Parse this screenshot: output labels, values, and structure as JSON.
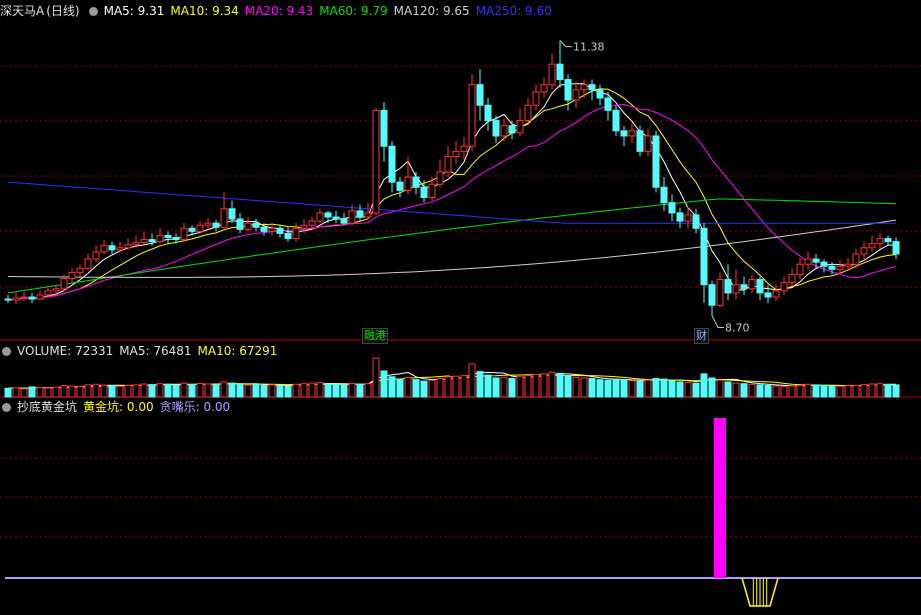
{
  "colors": {
    "background": "#000000",
    "up": "#ff3232",
    "down": "#54fcfc",
    "ma5": "#ffffff",
    "ma10": "#ffff00",
    "ma20": "#ff00ff",
    "ma60": "#00e000",
    "ma120": "#cfcfcf",
    "ma250": "#3030ff",
    "grid": "#8b0000",
    "separator": "#b00000",
    "signal_bar": "#ff00ff",
    "signal_baseline": "#b0a0ff",
    "trap": "#ffff00"
  },
  "main_panel": {
    "stock_name": "深天马A",
    "period": "(日线)",
    "ma_labels": [
      {
        "label": "MA5: 9.31",
        "color": "#ffffff"
      },
      {
        "label": "MA10: 9.34",
        "color": "#ffff00"
      },
      {
        "label": "MA20: 9.43",
        "color": "#ff00ff"
      },
      {
        "label": "MA60: 9.79",
        "color": "#00e000"
      },
      {
        "label": "MA120: 9.65",
        "color": "#cfcfcf"
      },
      {
        "label": "MA250: 9.60",
        "color": "#3030ff"
      }
    ],
    "max_label": "11.38",
    "min_label": "8.70",
    "tags": [
      "融港",
      "财"
    ]
  },
  "volume_panel": {
    "title": "VOLUME: 72331",
    "ma5": "MA5: 76481",
    "ma10": "MA10: 67291"
  },
  "indicator_panel": {
    "name": "抄底黄金坑",
    "gold": "黄金坑: 0.00",
    "greed": "贪嘴乐: 0.00"
  },
  "chart_data": {
    "type": "candlestick",
    "ylim": [
      8.5,
      11.6
    ],
    "candles": [
      [
        8.86,
        8.85,
        8.9,
        8.82
      ],
      [
        8.85,
        8.87,
        8.92,
        8.81
      ],
      [
        8.87,
        8.88,
        8.93,
        8.84
      ],
      [
        8.88,
        8.86,
        8.92,
        8.82
      ],
      [
        8.86,
        8.9,
        8.94,
        8.85
      ],
      [
        8.9,
        8.94,
        8.97,
        8.88
      ],
      [
        8.94,
        8.96,
        9.0,
        8.9
      ],
      [
        8.96,
        9.06,
        9.1,
        8.94
      ],
      [
        9.06,
        9.12,
        9.16,
        9.02
      ],
      [
        9.12,
        9.16,
        9.2,
        9.08
      ],
      [
        9.16,
        9.25,
        9.3,
        9.14
      ],
      [
        9.25,
        9.32,
        9.38,
        9.22
      ],
      [
        9.32,
        9.38,
        9.44,
        9.3
      ],
      [
        9.38,
        9.34,
        9.42,
        9.3
      ],
      [
        9.34,
        9.36,
        9.42,
        9.32
      ],
      [
        9.36,
        9.39,
        9.45,
        9.34
      ],
      [
        9.39,
        9.41,
        9.48,
        9.36
      ],
      [
        9.41,
        9.44,
        9.52,
        9.38
      ],
      [
        9.44,
        9.42,
        9.5,
        9.38
      ],
      [
        9.42,
        9.48,
        9.55,
        9.4
      ],
      [
        9.48,
        9.46,
        9.52,
        9.4
      ],
      [
        9.46,
        9.44,
        9.5,
        9.4
      ],
      [
        9.44,
        9.55,
        9.6,
        9.42
      ],
      [
        9.55,
        9.52,
        9.58,
        9.48
      ],
      [
        9.52,
        9.58,
        9.62,
        9.5
      ],
      [
        9.58,
        9.6,
        9.65,
        9.55
      ],
      [
        9.6,
        9.56,
        9.63,
        9.52
      ],
      [
        9.56,
        9.74,
        9.9,
        9.55
      ],
      [
        9.74,
        9.64,
        9.82,
        9.6
      ],
      [
        9.64,
        9.54,
        9.7,
        9.5
      ],
      [
        9.54,
        9.6,
        9.66,
        9.52
      ],
      [
        9.6,
        9.56,
        9.64,
        9.52
      ],
      [
        9.56,
        9.52,
        9.6,
        9.48
      ],
      [
        9.52,
        9.55,
        9.6,
        9.48
      ],
      [
        9.55,
        9.5,
        9.58,
        9.46
      ],
      [
        9.5,
        9.45,
        9.56,
        9.42
      ],
      [
        9.45,
        9.55,
        9.6,
        9.42
      ],
      [
        9.55,
        9.58,
        9.64,
        9.5
      ],
      [
        9.58,
        9.62,
        9.66,
        9.54
      ],
      [
        9.62,
        9.7,
        9.74,
        9.6
      ],
      [
        9.7,
        9.66,
        9.72,
        9.6
      ],
      [
        9.66,
        9.64,
        9.72,
        9.6
      ],
      [
        9.64,
        9.6,
        9.7,
        9.58
      ],
      [
        9.6,
        9.72,
        9.78,
        9.58
      ],
      [
        9.72,
        9.66,
        9.78,
        9.62
      ],
      [
        9.66,
        9.7,
        9.8,
        9.64
      ],
      [
        9.7,
        10.7,
        10.72,
        9.68
      ],
      [
        10.7,
        10.35,
        10.78,
        10.2
      ],
      [
        10.35,
        10.0,
        10.4,
        9.9
      ],
      [
        10.0,
        9.92,
        10.05,
        9.85
      ],
      [
        9.92,
        10.05,
        10.25,
        9.88
      ],
      [
        10.05,
        9.95,
        10.1,
        9.88
      ],
      [
        9.95,
        9.85,
        10.02,
        9.8
      ],
      [
        9.85,
        9.98,
        10.05,
        9.82
      ],
      [
        9.98,
        10.1,
        10.22,
        9.95
      ],
      [
        10.1,
        10.25,
        10.35,
        10.05
      ],
      [
        10.25,
        10.3,
        10.4,
        10.18
      ],
      [
        10.3,
        10.35,
        10.44,
        10.22
      ],
      [
        10.35,
        10.95,
        11.05,
        10.3
      ],
      [
        10.95,
        10.75,
        11.1,
        10.6
      ],
      [
        10.75,
        10.6,
        10.82,
        10.5
      ],
      [
        10.6,
        10.45,
        10.65,
        10.38
      ],
      [
        10.45,
        10.55,
        10.62,
        10.4
      ],
      [
        10.55,
        10.48,
        10.6,
        10.42
      ],
      [
        10.48,
        10.6,
        10.72,
        10.45
      ],
      [
        10.6,
        10.75,
        10.82,
        10.55
      ],
      [
        10.75,
        10.88,
        10.95,
        10.7
      ],
      [
        10.88,
        10.95,
        11.02,
        10.82
      ],
      [
        10.95,
        11.15,
        11.25,
        10.9
      ],
      [
        11.15,
        11.0,
        11.38,
        10.92
      ],
      [
        11.0,
        10.8,
        11.05,
        10.7
      ],
      [
        10.8,
        10.9,
        10.98,
        10.72
      ],
      [
        10.9,
        10.95,
        11.0,
        10.82
      ],
      [
        10.95,
        10.9,
        11.0,
        10.8
      ],
      [
        10.9,
        10.82,
        10.95,
        10.75
      ],
      [
        10.82,
        10.7,
        10.88,
        10.6
      ],
      [
        10.7,
        10.5,
        10.75,
        10.45
      ],
      [
        10.5,
        10.45,
        10.55,
        10.35
      ],
      [
        10.45,
        10.5,
        10.58,
        10.38
      ],
      [
        10.5,
        10.3,
        10.55,
        10.25
      ],
      [
        10.3,
        10.45,
        10.52,
        10.25
      ],
      [
        10.45,
        9.95,
        10.5,
        9.9
      ],
      [
        9.95,
        9.8,
        10.05,
        9.72
      ],
      [
        9.8,
        9.7,
        9.88,
        9.62
      ],
      [
        9.7,
        9.62,
        9.75,
        9.55
      ],
      [
        9.62,
        9.68,
        9.76,
        9.55
      ],
      [
        9.68,
        9.55,
        9.74,
        9.5
      ],
      [
        9.55,
        9.0,
        9.6,
        8.82
      ],
      [
        9.0,
        8.8,
        9.04,
        8.7
      ],
      [
        8.8,
        9.05,
        9.12,
        8.78
      ],
      [
        9.05,
        8.92,
        9.2,
        8.85
      ],
      [
        8.92,
        9.0,
        9.15,
        8.86
      ],
      [
        9.0,
        8.96,
        9.08,
        8.9
      ],
      [
        8.96,
        9.05,
        9.1,
        8.92
      ],
      [
        9.05,
        8.92,
        9.08,
        8.85
      ],
      [
        8.92,
        8.88,
        9.0,
        8.82
      ],
      [
        8.88,
        8.94,
        9.0,
        8.84
      ],
      [
        8.94,
        9.02,
        9.08,
        8.9
      ],
      [
        9.02,
        9.1,
        9.16,
        8.98
      ],
      [
        9.1,
        9.2,
        9.26,
        9.05
      ],
      [
        9.2,
        9.25,
        9.32,
        9.15
      ],
      [
        9.25,
        9.22,
        9.3,
        9.16
      ],
      [
        9.22,
        9.18,
        9.25,
        9.12
      ],
      [
        9.18,
        9.15,
        9.22,
        9.1
      ],
      [
        9.15,
        9.18,
        9.24,
        9.1
      ],
      [
        9.18,
        9.2,
        9.26,
        9.14
      ],
      [
        9.2,
        9.3,
        9.35,
        9.16
      ],
      [
        9.3,
        9.36,
        9.42,
        9.25
      ],
      [
        9.36,
        9.4,
        9.48,
        9.32
      ],
      [
        9.4,
        9.45,
        9.5,
        9.35
      ],
      [
        9.45,
        9.42,
        9.48,
        9.38
      ],
      [
        9.42,
        9.3,
        9.46,
        9.25
      ]
    ],
    "ma": {
      "ma20_end": 9.43,
      "ma60_end": 9.79,
      "ma120_end": 9.65,
      "ma250_end": 9.6
    },
    "volume": [
      30,
      32,
      28,
      35,
      33,
      31,
      34,
      40,
      38,
      36,
      42,
      44,
      41,
      39,
      37,
      40,
      42,
      45,
      43,
      46,
      44,
      41,
      48,
      43,
      47,
      45,
      42,
      52,
      48,
      43,
      41,
      44,
      40,
      42,
      39,
      38,
      44,
      46,
      48,
      50,
      45,
      43,
      42,
      47,
      44,
      46,
      135,
      90,
      70,
      62,
      68,
      60,
      55,
      58,
      64,
      70,
      72,
      74,
      115,
      88,
      76,
      66,
      68,
      64,
      70,
      74,
      78,
      80,
      86,
      82,
      74,
      68,
      66,
      64,
      60,
      58,
      62,
      60,
      56,
      54,
      58,
      64,
      62,
      56,
      52,
      50,
      48,
      80,
      66,
      58,
      52,
      48,
      46,
      44,
      42,
      40,
      38,
      36,
      38,
      40,
      44,
      42,
      40,
      38,
      37,
      39,
      40,
      43,
      45,
      46,
      44,
      42
    ],
    "indicator": {
      "gold_signal_index": 89,
      "trap_start_index": 92,
      "trap_end_index": 96
    }
  }
}
